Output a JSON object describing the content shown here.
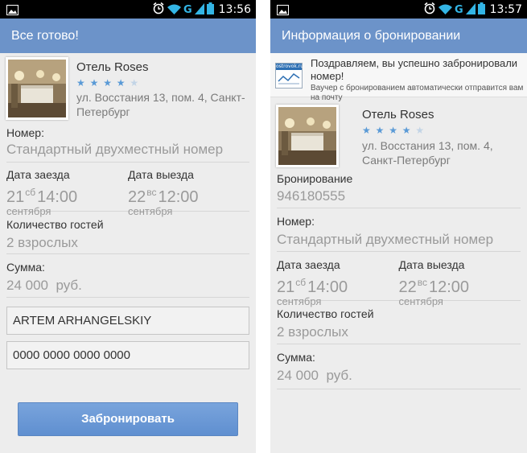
{
  "left": {
    "status": {
      "time": "13:56",
      "network": "G"
    },
    "actionbar_title": "Все готово!",
    "hotel": {
      "name": "Отель Roses",
      "address": "ул. Восстания 13, пом. 4, Санкт-Петербург",
      "stars": 4,
      "stars_max": 5
    },
    "room": {
      "label": "Номер:",
      "value": "Стандартный двухместный номер"
    },
    "checkin": {
      "label": "Дата заезда",
      "day": "21",
      "weekday": "сб",
      "time": "14:00",
      "month": "сентября"
    },
    "checkout": {
      "label": "Дата выезда",
      "day": "22",
      "weekday": "вс",
      "time": "12:00",
      "month": "сентября"
    },
    "guests": {
      "label": "Количество гостей",
      "value": "2 взрослых"
    },
    "sum": {
      "label": "Сумма:",
      "value": "24 000  руб."
    },
    "name_field": "ARTEM ARHANGELSKIY",
    "card_field": "0000 0000 0000 0000",
    "book_button": "Забронировать"
  },
  "right": {
    "status": {
      "time": "13:57",
      "network": "G"
    },
    "actionbar_title": "Информация о бронировании",
    "notice": {
      "logo": "ostrovok.ru",
      "title": "Поздравляем, вы успешно забронировали номер!",
      "subtitle": "Ваучер с бронированием автоматически отправится вам на почту"
    },
    "hotel": {
      "name": "Отель Roses",
      "address": "ул. Восстания 13, пом. 4, Санкт-Петербург",
      "stars": 4,
      "stars_max": 5
    },
    "booking": {
      "label": "Бронирование",
      "value": "946180555"
    },
    "room": {
      "label": "Номер:",
      "value": "Стандартный двухместный номер"
    },
    "checkin": {
      "label": "Дата заезда",
      "day": "21",
      "weekday": "сб",
      "time": "14:00",
      "month": "сентября"
    },
    "checkout": {
      "label": "Дата выезда",
      "day": "22",
      "weekday": "вс",
      "time": "12:00",
      "month": "сентября"
    },
    "guests": {
      "label": "Количество гостей",
      "value": "2 взрослых"
    },
    "sum": {
      "label": "Сумма:",
      "value": "24 000  руб."
    }
  },
  "icons": [
    "image-icon",
    "alarm-icon",
    "wifi-icon",
    "signal-icon",
    "battery-icon",
    "star-icon"
  ],
  "colors": {
    "actionbar": "#6c93c9",
    "button": "#6b98d6",
    "stars": "#5a9ad6",
    "wifi": "#33b5e5"
  }
}
